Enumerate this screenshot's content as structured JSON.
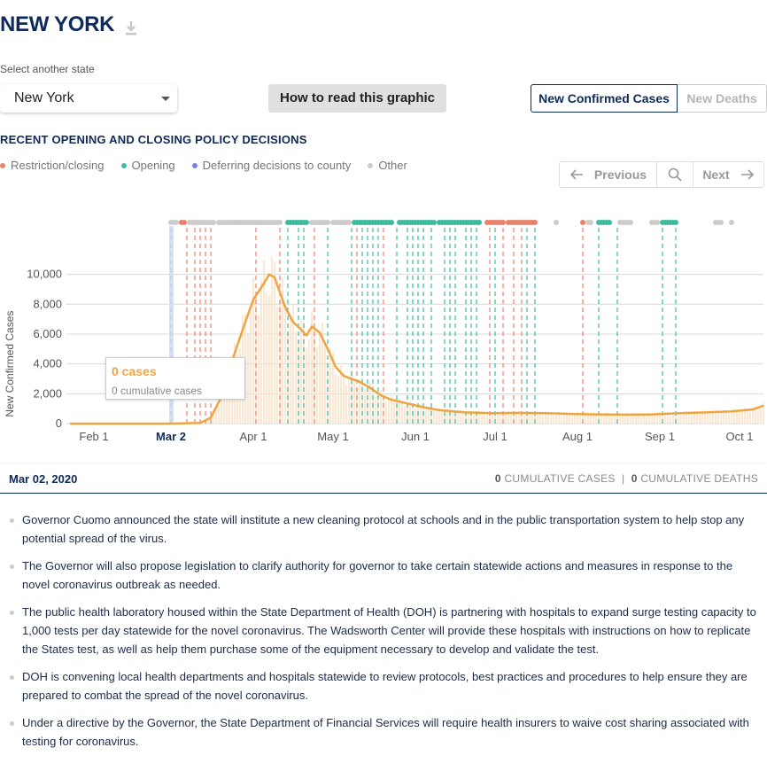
{
  "header": {
    "title": "NEW YORK"
  },
  "state_select": {
    "label": "Select another state",
    "value": "New York"
  },
  "how_to_button": "How to read this graphic",
  "tabs": [
    {
      "label": "New Confirmed Cases"
    },
    {
      "label": "New Deaths"
    }
  ],
  "policy": {
    "title": "RECENT OPENING AND CLOSING POLICY DECISIONS",
    "legend": [
      {
        "label": "Restriction/closing",
        "color": "#e8826b"
      },
      {
        "label": "Opening",
        "color": "#3dbb9e"
      },
      {
        "label": "Deferring decisions to county",
        "color": "#7b7fe6"
      },
      {
        "label": "Other",
        "color": "#cccccc"
      }
    ]
  },
  "pager": {
    "previous": "Previous",
    "next": "Next"
  },
  "tooltip": {
    "cases": "0 cases",
    "cumulative": "0 cumulative cases"
  },
  "date_bar": {
    "date": "Mar 02, 2020",
    "cases_value": "0",
    "cases_label": "CUMULATIVE CASES",
    "deaths_value": "0",
    "deaths_label": "CUMULATIVE DEATHS"
  },
  "notes": [
    "Governor Cuomo announced the state will institute a new cleaning protocol at schools and in the public transportation system to help stop any potential spread of the virus.",
    "The Governor will also propose legislation to clarify authority for governor to take certain statewide actions and measures in response to the novel coronavirus outbreak as needed.",
    "The public health laboratory housed within the State Department of Health (DOH) is partnering with hospitals to expand surge testing capacity to 1,000 tests per day statewide for the novel coronavirus. The Wadsworth Center will provide these hospitals with instructions on how to replicate the States test, as well as help them purchase some of the equipment necessary to develop and validate the test.",
    "DOH is convening local health departments and hospitals statewide to review protocols, best practices and procedures to help ensure they are prepared to combat the spread of the novel coronavirus.",
    "Under a directive by the Governor, the State Department of Financial Services will require health insurers to waive cost sharing associated with testing for coronavirus."
  ],
  "chart_data": {
    "type": "line",
    "ylabel": "New Confirmed Cases",
    "ylim": [
      0,
      10000
    ],
    "yticks": [
      0,
      2000,
      4000,
      6000,
      8000,
      10000
    ],
    "ytick_labels": [
      "0",
      "2,000",
      "4,000",
      "6,000",
      "8,000",
      "10,000"
    ],
    "xticks": [
      {
        "day": 0,
        "label": "Feb 1"
      },
      {
        "day": 29,
        "label": "Mar 2"
      },
      {
        "day": 60,
        "label": "Apr 1"
      },
      {
        "day": 90,
        "label": "May 1"
      },
      {
        "day": 121,
        "label": "Jun 1"
      },
      {
        "day": 151,
        "label": "Jul 1"
      },
      {
        "day": 182,
        "label": "Aug 1"
      },
      {
        "day": 213,
        "label": "Sep 1"
      },
      {
        "day": 243,
        "label": "Oct 1"
      }
    ],
    "highlight_day": 29,
    "series": [
      {
        "color": "#f0a43f",
        "points": [
          [
            -9,
            0
          ],
          [
            29,
            0
          ],
          [
            40,
            50
          ],
          [
            44,
            400
          ],
          [
            48,
            1800
          ],
          [
            52,
            4200
          ],
          [
            56,
            6300
          ],
          [
            60,
            8300
          ],
          [
            64,
            9400
          ],
          [
            66,
            10000
          ],
          [
            68,
            9800
          ],
          [
            70,
            8800
          ],
          [
            72,
            7800
          ],
          [
            75,
            6800
          ],
          [
            78,
            6300
          ],
          [
            80,
            5900
          ],
          [
            82,
            6500
          ],
          [
            85,
            6100
          ],
          [
            88,
            5000
          ],
          [
            91,
            3800
          ],
          [
            94,
            3200
          ],
          [
            97,
            3000
          ],
          [
            100,
            2800
          ],
          [
            104,
            2400
          ],
          [
            108,
            1900
          ],
          [
            112,
            1600
          ],
          [
            118,
            1350
          ],
          [
            124,
            1100
          ],
          [
            130,
            900
          ],
          [
            140,
            750
          ],
          [
            150,
            700
          ],
          [
            160,
            720
          ],
          [
            170,
            700
          ],
          [
            180,
            650
          ],
          [
            190,
            620
          ],
          [
            200,
            600
          ],
          [
            210,
            620
          ],
          [
            220,
            700
          ],
          [
            230,
            750
          ],
          [
            240,
            820
          ],
          [
            248,
            950
          ],
          [
            252,
            1200
          ]
        ]
      }
    ],
    "policy_events": [
      {
        "day": 29,
        "type": "other"
      },
      {
        "day": 35,
        "type": "closing"
      },
      {
        "day": 38,
        "type": "closing"
      },
      {
        "day": 40,
        "type": "closing"
      },
      {
        "day": 42,
        "type": "closing"
      },
      {
        "day": 44,
        "type": "closing"
      },
      {
        "day": 61,
        "type": "closing"
      },
      {
        "day": 70,
        "type": "closing"
      },
      {
        "day": 73,
        "type": "opening"
      },
      {
        "day": 77,
        "type": "opening"
      },
      {
        "day": 79,
        "type": "opening"
      },
      {
        "day": 83,
        "type": "closing"
      },
      {
        "day": 88,
        "type": "opening"
      },
      {
        "day": 97,
        "type": "opening"
      },
      {
        "day": 99,
        "type": "closing"
      },
      {
        "day": 101,
        "type": "opening"
      },
      {
        "day": 103,
        "type": "opening"
      },
      {
        "day": 105,
        "type": "opening"
      },
      {
        "day": 107,
        "type": "opening"
      },
      {
        "day": 109,
        "type": "closing"
      },
      {
        "day": 114,
        "type": "opening"
      },
      {
        "day": 118,
        "type": "opening"
      },
      {
        "day": 120,
        "type": "opening"
      },
      {
        "day": 122,
        "type": "opening"
      },
      {
        "day": 124,
        "type": "opening"
      },
      {
        "day": 127,
        "type": "opening"
      },
      {
        "day": 132,
        "type": "opening"
      },
      {
        "day": 134,
        "type": "opening"
      },
      {
        "day": 136,
        "type": "opening"
      },
      {
        "day": 140,
        "type": "opening"
      },
      {
        "day": 142,
        "type": "opening"
      },
      {
        "day": 144,
        "type": "opening"
      },
      {
        "day": 149,
        "type": "closing"
      },
      {
        "day": 151,
        "type": "opening"
      },
      {
        "day": 154,
        "type": "closing"
      },
      {
        "day": 158,
        "type": "closing"
      },
      {
        "day": 161,
        "type": "closing"
      },
      {
        "day": 163,
        "type": "opening"
      },
      {
        "day": 166,
        "type": "opening"
      },
      {
        "day": 184,
        "type": "closing"
      },
      {
        "day": 190,
        "type": "opening"
      },
      {
        "day": 197,
        "type": "opening"
      },
      {
        "day": 214,
        "type": "opening"
      },
      {
        "day": 219,
        "type": "opening"
      }
    ],
    "dot_rows": [
      {
        "start": 29,
        "end": 31,
        "type": "other"
      },
      {
        "start": 33,
        "end": 34,
        "type": "closing"
      },
      {
        "start": 36,
        "end": 45,
        "type": "other"
      },
      {
        "start": 47,
        "end": 70,
        "type": "other"
      },
      {
        "start": 73,
        "end": 80,
        "type": "opening"
      },
      {
        "start": 82,
        "end": 88,
        "type": "other"
      },
      {
        "start": 90,
        "end": 96,
        "type": "other"
      },
      {
        "start": 98,
        "end": 112,
        "type": "opening"
      },
      {
        "start": 115,
        "end": 128,
        "type": "opening"
      },
      {
        "start": 130,
        "end": 145,
        "type": "opening"
      },
      {
        "start": 148,
        "end": 154,
        "type": "closing"
      },
      {
        "start": 156,
        "end": 166,
        "type": "closing"
      },
      {
        "start": 174,
        "end": 174,
        "type": "other"
      },
      {
        "start": 184,
        "end": 184,
        "type": "closing"
      },
      {
        "start": 186,
        "end": 187,
        "type": "other"
      },
      {
        "start": 190,
        "end": 194,
        "type": "opening"
      },
      {
        "start": 198,
        "end": 202,
        "type": "other"
      },
      {
        "start": 210,
        "end": 212,
        "type": "other"
      },
      {
        "start": 214,
        "end": 219,
        "type": "opening"
      },
      {
        "start": 234,
        "end": 236,
        "type": "other"
      },
      {
        "start": 240,
        "end": 240,
        "type": "other"
      }
    ]
  }
}
